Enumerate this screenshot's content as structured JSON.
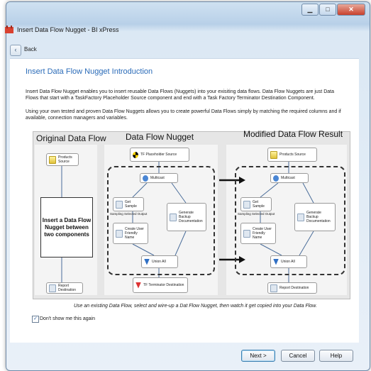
{
  "window": {
    "title": "Insert Data Flow Nugget - BI xPress",
    "minimize_glyph": "▁",
    "maximize_glyph": "□",
    "close_glyph": "✕"
  },
  "nav": {
    "back_label": "Back",
    "back_glyph": "‹"
  },
  "main": {
    "heading": "Insert Data Flow Nugget Introduction",
    "paragraph1": "Insert Data Flow Nugget enables you to insert reusable Data Flows (Nuggets) into your exisiting data flows.  Data Flow Nuggets are just Data Flows that start with a TaskFactory Placeholder Source component and end with a Task Factory Terminator Destination Component.",
    "paragraph2": "Using your own tested and proven Data Flow Nuggets allows you to create powerful Data Flows simply by matching the required columns and if available, connection managers and variables."
  },
  "diagram": {
    "panel_original": "Original Data Flow",
    "panel_nugget": "Data Flow Nugget",
    "panel_modified": "Modified Data Flow Result",
    "insert_box": "Insert a Data Flow Nugget between two components",
    "products_source": "Products Source",
    "report_destination": "Report Destination",
    "tf_placeholder": "TF Placeholder Source",
    "multicast": "Multicast",
    "get_sample": "Get Sample",
    "sampling_output": "Sampling Selected Output",
    "create_user": "Create User Friendly Name",
    "generate_backup": "Generate Backup Documentation",
    "union_all": "Union All",
    "tf_terminator": "TF Terminator Destination"
  },
  "caption": "Use an existing Data Flow, select and wire-up a Dat Flow Nugget, then watch it get copied into your Data Flow.",
  "options": {
    "dont_show_label": "Don't show me this again",
    "dont_show_checked": true,
    "check_glyph": "✓"
  },
  "footer": {
    "next_label": "Next >",
    "cancel_label": "Cancel",
    "help_label": "Help"
  }
}
